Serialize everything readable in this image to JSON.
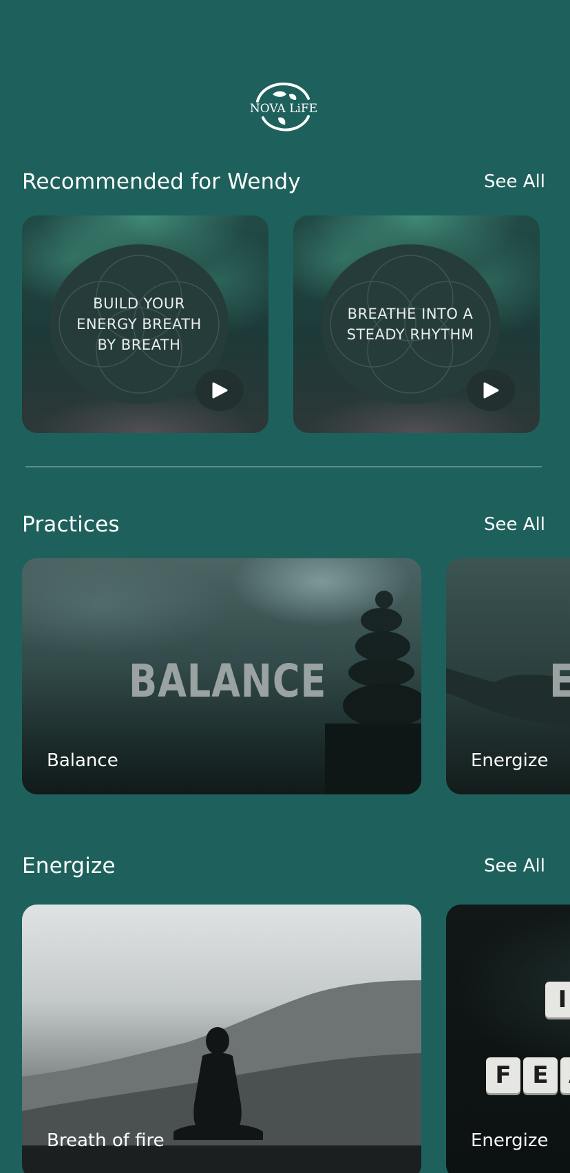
{
  "brand": {
    "logo_text": "NOVA LiFE"
  },
  "recommended": {
    "title": "Recommended for Wendy",
    "see_all": "See All",
    "cards": [
      {
        "text": "BUILD YOUR\nENERGY BREATH\nBY BREATH"
      },
      {
        "text": "BREATHE INTO A\nSTEADY RHYTHM"
      }
    ]
  },
  "practices": {
    "title": "Practices",
    "see_all": "See All",
    "cards": [
      {
        "label": "Balance",
        "image_text": "BALANCE"
      },
      {
        "label": "Energize",
        "image_text": "E"
      }
    ]
  },
  "energize": {
    "title": "Energize",
    "see_all": "See All",
    "cards": [
      {
        "label": "Breath of fire"
      },
      {
        "label": "Energize",
        "tiles_row1": [
          "I"
        ],
        "tiles_row2": [
          "F",
          "E",
          "A"
        ]
      }
    ]
  },
  "icons": {
    "play": "play-icon",
    "logo": "globe-logo-icon"
  }
}
